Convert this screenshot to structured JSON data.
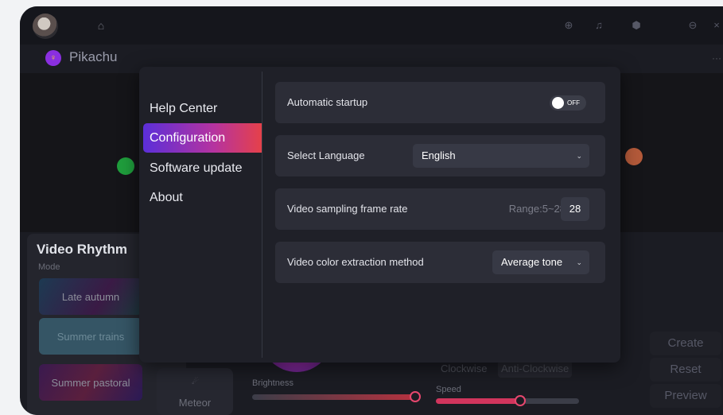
{
  "app": {
    "device_name": "Pikachu"
  },
  "settings_menu": {
    "items": [
      "Help Center",
      "Configuration",
      "Software update",
      "About"
    ],
    "active_index": 1
  },
  "configuration": {
    "auto_startup": {
      "label": "Automatic startup",
      "state": "OFF"
    },
    "language": {
      "label": "Select Language",
      "value": "English"
    },
    "frame_rate": {
      "label": "Video sampling frame rate",
      "range_text": "Range:5~28",
      "value": "28"
    },
    "color_method": {
      "label": "Video color extraction method",
      "value": "Average tone"
    }
  },
  "video_rhythm": {
    "title": "Video Rhythm",
    "mode_label": "Mode",
    "modes": [
      "Late autumn",
      "Summer trains",
      "Summer pastoral"
    ],
    "effect": "Meteor"
  },
  "controls": {
    "brightness_label": "Brightness",
    "speed_label": "Speed",
    "clockwise": "Clockwise",
    "anti_clockwise": "Anti-Clockwise"
  },
  "actions": {
    "create": "Create",
    "reset": "Reset",
    "preview": "Preview"
  },
  "colors": {
    "accent_gradient_start": "#5b2fd9",
    "accent_gradient_end": "#e5414a",
    "slider": "#e6476e",
    "background": "#1b1c23"
  }
}
